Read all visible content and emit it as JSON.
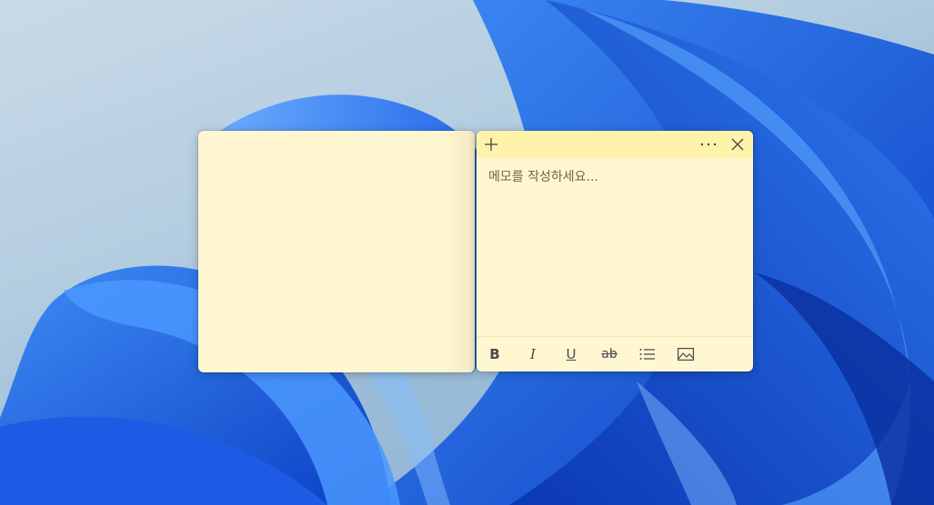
{
  "desktop": {
    "wallpaper": "windows-11-bloom",
    "accent_color": "#1a5fe0"
  },
  "note_left": {
    "color": "#fff7d1"
  },
  "note_right": {
    "color": "#fff7d1",
    "header_color": "#fff2ab",
    "placeholder": "메모를 작성하세요...",
    "header": {
      "add_icon": "plus-icon",
      "menu_icon": "more-horizontal-icon",
      "close_icon": "close-icon"
    },
    "toolbar": {
      "bold_label": "B",
      "italic_label": "I",
      "underline_label": "U",
      "strike_label": "ab",
      "list_icon": "bullet-list-icon",
      "image_icon": "image-icon"
    }
  }
}
